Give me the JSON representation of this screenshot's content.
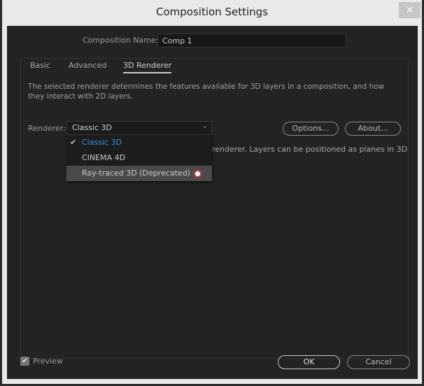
{
  "window": {
    "title": "Composition Settings",
    "close_label": "×"
  },
  "composition_name": {
    "label": "Composition Name:",
    "value": "Comp 1"
  },
  "tabs": [
    {
      "label": "Basic"
    },
    {
      "label": "Advanced"
    },
    {
      "label": "3D Renderer",
      "active": true
    }
  ],
  "description": "The selected renderer determines the features available for 3D layers in a composition, and how they interact with 2D layers.",
  "renderer": {
    "label": "Renderer:",
    "value": "Classic 3D",
    "options": [
      {
        "label": "Classic 3D",
        "checked": true
      },
      {
        "label": "CINEMA 4D"
      },
      {
        "label": "Ray-traced 3D (Deprecated)",
        "hovered": true
      }
    ],
    "info_text_visible": "renderer. Layers can be positioned as planes in 3D"
  },
  "buttons": {
    "options": "Options...",
    "about": "About...",
    "ok": "OK",
    "cancel": "Cancel"
  },
  "preview": {
    "label": "Preview",
    "checked": true
  },
  "colors": {
    "accent": "#3d8fdc",
    "background": "#232323",
    "frame": "#e9e9e9"
  }
}
